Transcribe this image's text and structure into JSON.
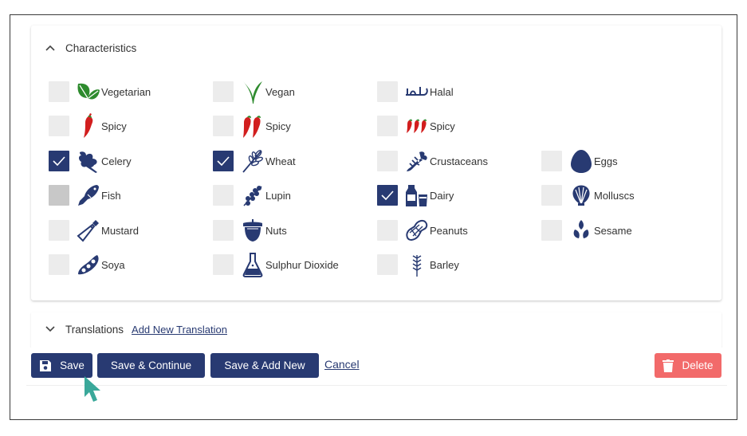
{
  "characteristics": {
    "title": "Characteristics",
    "items": [
      {
        "label": "Vegetarian",
        "icon": "leaves-icon",
        "checked": false
      },
      {
        "label": "Vegan",
        "icon": "sprout-icon",
        "checked": false
      },
      {
        "label": "Halal",
        "icon": "halal-icon",
        "checked": false
      },
      {
        "label": "Spicy",
        "icon": "chili-1-icon",
        "checked": false
      },
      {
        "label": "Spicy",
        "icon": "chili-2-icon",
        "checked": false
      },
      {
        "label": "Spicy",
        "icon": "chili-3-icon",
        "checked": false
      },
      {
        "label": "Celery",
        "icon": "celery-icon",
        "checked": true
      },
      {
        "label": "Wheat",
        "icon": "wheat-icon",
        "checked": true
      },
      {
        "label": "Crustaceans",
        "icon": "lobster-icon",
        "checked": false
      },
      {
        "label": "Eggs",
        "icon": "egg-icon",
        "checked": false
      },
      {
        "label": "Fish",
        "icon": "fish-icon",
        "checked": false,
        "disabled": true
      },
      {
        "label": "Lupin",
        "icon": "lupin-icon",
        "checked": false
      },
      {
        "label": "Dairy",
        "icon": "dairy-icon",
        "checked": true
      },
      {
        "label": "Molluscs",
        "icon": "shell-icon",
        "checked": false
      },
      {
        "label": "Mustard",
        "icon": "mustard-bottle-icon",
        "checked": false
      },
      {
        "label": "Nuts",
        "icon": "nut-icon",
        "checked": false
      },
      {
        "label": "Peanuts",
        "icon": "peanut-icon",
        "checked": false
      },
      {
        "label": "Sesame",
        "icon": "sesame-icon",
        "checked": false
      },
      {
        "label": "Soya",
        "icon": "soybean-icon",
        "checked": false
      },
      {
        "label": "Sulphur Dioxide",
        "icon": "flask-icon",
        "checked": false
      },
      {
        "label": "Barley",
        "icon": "barley-icon",
        "checked": false
      }
    ]
  },
  "translations": {
    "title": "Translations",
    "add_link": "Add New Translation"
  },
  "actions": {
    "save": "Save",
    "save_continue": "Save & Continue",
    "save_add_new": "Save & Add New",
    "cancel": "Cancel",
    "delete": "Delete"
  },
  "colors": {
    "primary": "#283a72",
    "delete": "#f26a6a",
    "green": "#2e8b2e",
    "red": "#d21e1e",
    "cursor": "#3aa89a"
  }
}
